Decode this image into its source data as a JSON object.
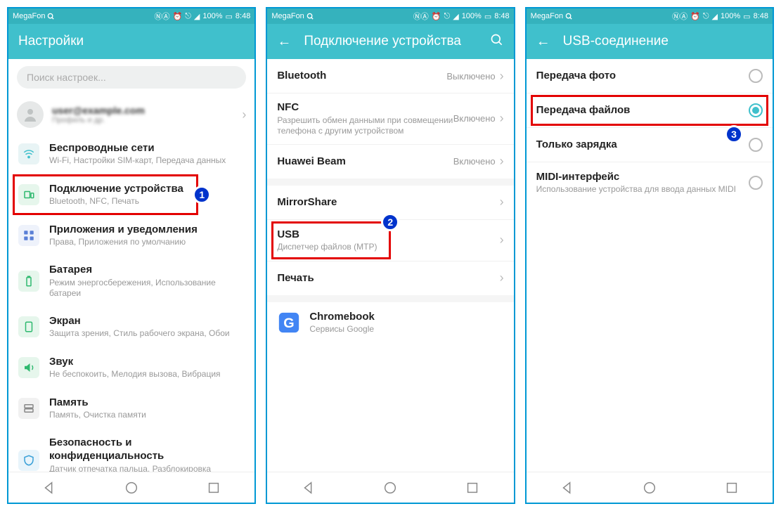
{
  "statusbar": {
    "carrier": "MegaFon",
    "icons": "ⓃⒶ ⎋ ◢ 100%",
    "battery": "▭",
    "time": "8:48"
  },
  "screen1": {
    "header": {
      "title": "Настройки"
    },
    "search": {
      "placeholder": "Поиск настроек..."
    },
    "profile": {
      "name": "user@example.com",
      "sub": "Профиль и др."
    },
    "items": [
      {
        "title": "Беспроводные сети",
        "sub": "Wi-Fi, Настройки SIM-карт, Передача данных"
      },
      {
        "title": "Подключение устройства",
        "sub": "Bluetooth, NFC, Печать"
      },
      {
        "title": "Приложения и уведомления",
        "sub": "Права, Приложения по умолчанию"
      },
      {
        "title": "Батарея",
        "sub": "Режим энергосбережения, Использование батареи"
      },
      {
        "title": "Экран",
        "sub": "Защита зрения, Стиль рабочего экрана, Обои"
      },
      {
        "title": "Звук",
        "sub": "Не беспокоить, Мелодия вызова, Вибрация"
      },
      {
        "title": "Память",
        "sub": "Память, Очистка памяти"
      },
      {
        "title": "Безопасность и конфиденциальность",
        "sub": "Датчик отпечатка пальца, Разблокировка распознаванием лица, Блокировка экрана"
      }
    ]
  },
  "screen2": {
    "header": {
      "title": "Подключение устройства"
    },
    "items": [
      {
        "title": "Bluetooth",
        "status": "Выключено"
      },
      {
        "title": "NFC",
        "sub": "Разрешить обмен данными при совмещении телефона с другим устройством",
        "status": "Включено"
      },
      {
        "title": "Huawei Beam",
        "status": "Включено"
      },
      {
        "title": "MirrorShare"
      },
      {
        "title": "USB",
        "sub": "Диспетчер файлов (MTP)"
      },
      {
        "title": "Печать"
      },
      {
        "title": "Chromebook",
        "sub": "Сервисы Google"
      }
    ]
  },
  "screen3": {
    "header": {
      "title": "USB-соединение"
    },
    "items": [
      {
        "title": "Передача фото",
        "checked": false
      },
      {
        "title": "Передача файлов",
        "checked": true
      },
      {
        "title": "Только зарядка",
        "checked": false
      },
      {
        "title": "MIDI-интерфейс",
        "sub": "Использование устройства для ввода данных MIDI",
        "checked": false
      }
    ]
  },
  "badges": {
    "b1": "1",
    "b2": "2",
    "b3": "3"
  }
}
